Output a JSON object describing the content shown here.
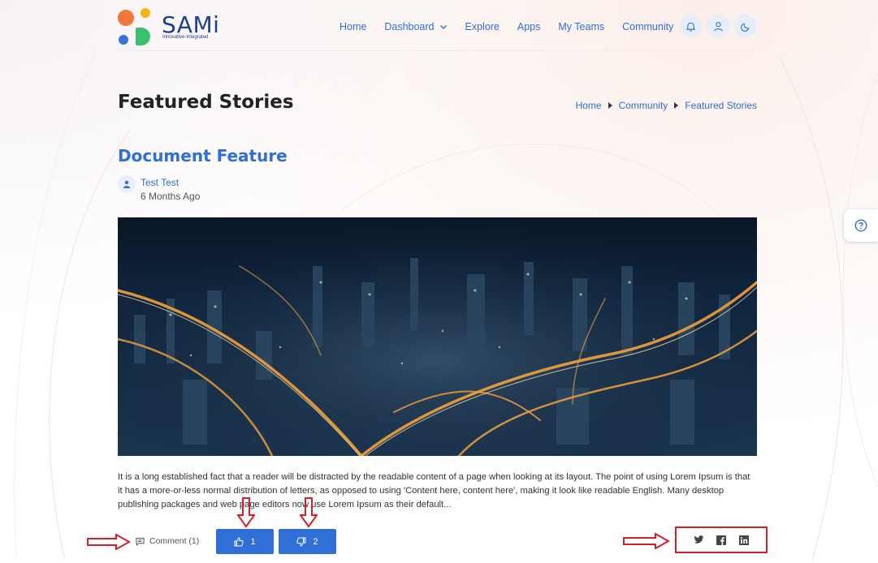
{
  "brand": {
    "name": "SAMi",
    "tagline": "Innovative-Integrated",
    "colors": {
      "orange": "#f2783a",
      "yellow": "#f6b21b",
      "blue": "#3a72d8",
      "green": "#3cbf6a",
      "navy": "#1e3f8f"
    }
  },
  "nav": {
    "items": [
      {
        "label": "Home",
        "has_dropdown": false
      },
      {
        "label": "Dashboard",
        "has_dropdown": true
      },
      {
        "label": "Explore",
        "has_dropdown": false
      },
      {
        "label": "Apps",
        "has_dropdown": false
      },
      {
        "label": "My Teams",
        "has_dropdown": false
      },
      {
        "label": "Community",
        "has_dropdown": true
      }
    ],
    "icons": [
      "bell-icon",
      "user-icon",
      "moon-icon"
    ]
  },
  "page": {
    "title": "Featured Stories",
    "breadcrumb": [
      "Home",
      "Community",
      "Featured Stories"
    ]
  },
  "article": {
    "title": "Document Feature",
    "author": "Test Test",
    "posted": "6 Months Ago",
    "image_alt": "city-night-aerial-photo",
    "body": "It is a long established fact that a reader will be distracted by the readable content of a page when looking at its layout. The point of using Lorem Ipsum is that it has a more-or-less normal distribution of letters, as opposed to using 'Content here, content here', making it look like readable English. Many desktop publishing packages and web page editors now use Lorem Ipsum as their default..."
  },
  "actions": {
    "comment_label": "Comment (1)",
    "likes": "1",
    "dislikes": "2",
    "share": [
      "twitter-icon",
      "facebook-icon",
      "linkedin-icon"
    ]
  },
  "help": {
    "icon": "help-circle-icon"
  },
  "accent": "#2f6fd6",
  "annotation_color": "#d61f26"
}
